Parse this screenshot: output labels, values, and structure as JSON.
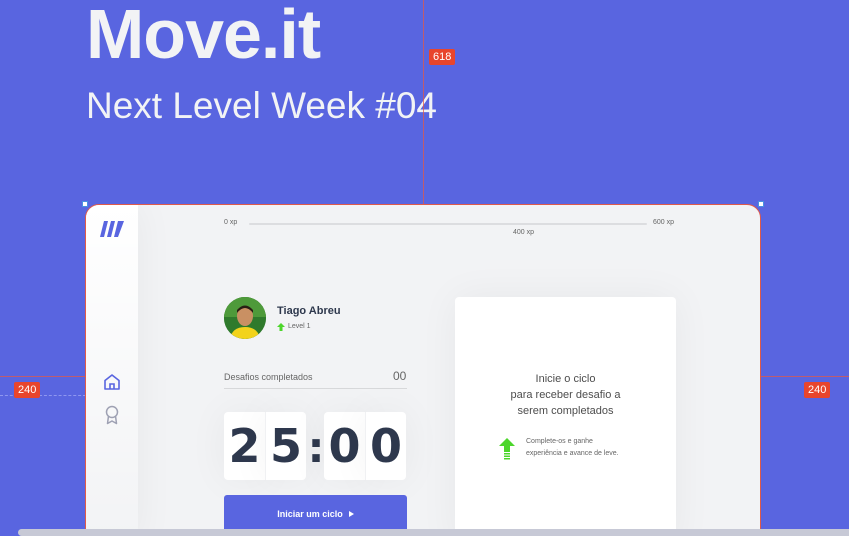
{
  "hero": {
    "title": "Move.it",
    "subtitle": "Next Level Week #04"
  },
  "guides": {
    "badge_top": "618",
    "badge_left": "240",
    "badge_right": "240",
    "color": "#E8452C"
  },
  "colors": {
    "background": "#5965E0",
    "app_background": "#F2F3F5",
    "primary": "#5965E0",
    "text_dark": "#2E384D",
    "level_green": "#4CD62B"
  },
  "sidebar": {
    "items": [
      {
        "icon": "home-icon"
      },
      {
        "icon": "award-icon"
      }
    ]
  },
  "xp_bar": {
    "min_label": "0 xp",
    "max_label": "600 xp",
    "current_label": "400 xp"
  },
  "profile": {
    "name": "Tiago Abreu",
    "level": "Level 1"
  },
  "completed": {
    "label": "Desafios completados",
    "count": "00"
  },
  "countdown": {
    "minute_left": "2",
    "minute_right": "5",
    "separator": ":",
    "second_left": "0",
    "second_right": "0"
  },
  "start_button": {
    "label": "Iniciar um ciclo"
  },
  "challenge": {
    "title_line1": "Inicie o ciclo",
    "title_line2": "para receber desafio a",
    "title_line3": "serem completados",
    "hint_line1": "Complete-os e ganhe",
    "hint_line2": "experiência e avance de leve."
  }
}
